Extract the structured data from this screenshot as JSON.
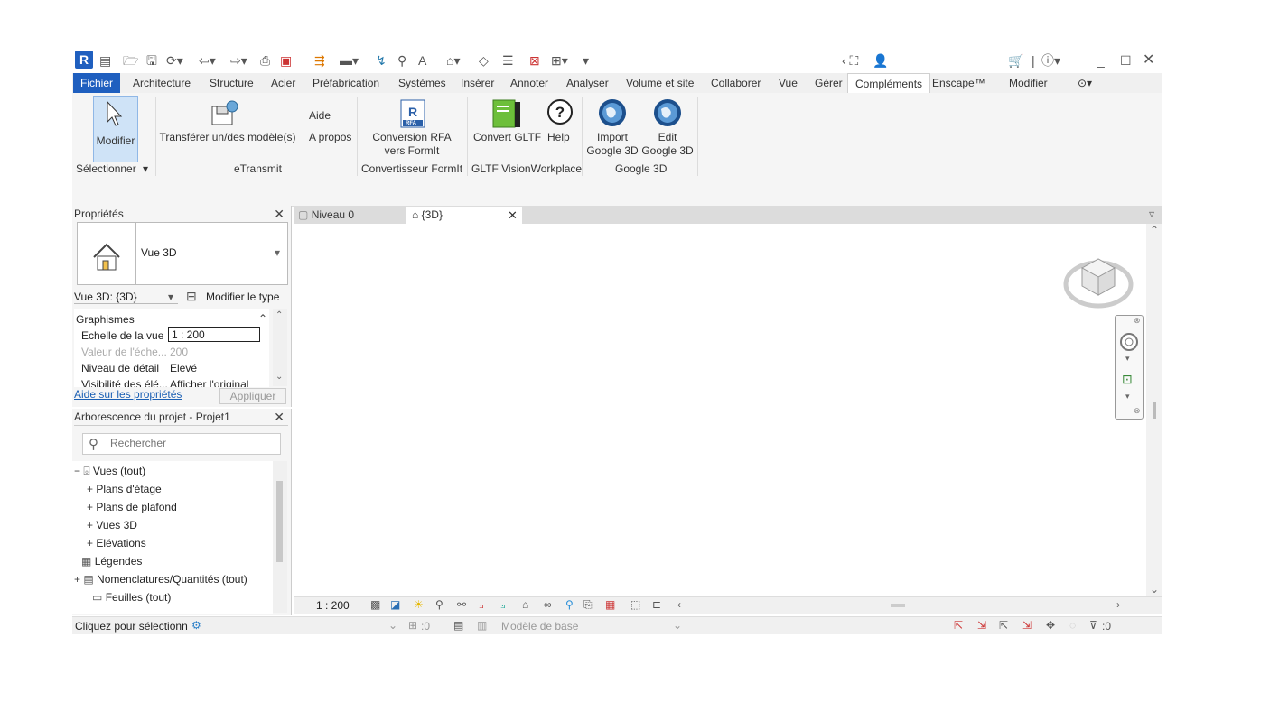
{
  "colors": {
    "accent": "#1f5fbf",
    "ribbon_bg": "#f5f5f5",
    "active_button": "#cfe3f7"
  },
  "app": {
    "logo": "R"
  },
  "ribbon_tabs": [
    "Fichier",
    "Architecture",
    "Structure",
    "Acier",
    "Préfabrication",
    "Systèmes",
    "Insérer",
    "Annoter",
    "Analyser",
    "Volume et site",
    "Collaborer",
    "Vue",
    "Gérer",
    "Compléments",
    "Enscape™",
    "Modifier"
  ],
  "active_tab": "Compléments",
  "ribbon": {
    "modify": "Modifier",
    "select_panel": "Sélectionner",
    "etransmit_button": "Transférer un/des modèle(s)",
    "etransmit_panel": "eTransmit",
    "help_link": "Aide",
    "about_link": "A propos",
    "conversion_line1": "Conversion RFA",
    "conversion_line2": "vers FormIt",
    "rfa_badge": "RFA",
    "formit_panel": "Convertisseur FormIt",
    "convert_gltf": "Convert GLTF",
    "help_gltf": "Help",
    "gltf_panel": "GLTF VisionWorkplace",
    "import_g3d_1": "Import",
    "import_g3d_2": "Google 3D",
    "edit_g3d_1": "Edit",
    "edit_g3d_2": "Google 3D",
    "google_panel": "Google 3D"
  },
  "properties": {
    "title": "Propriétés",
    "type_name": "Vue 3D",
    "instance_selector": "Vue 3D: {3D}",
    "edit_type": "Modifier le type",
    "section": "Graphismes",
    "rows": [
      {
        "label": "Echelle de la vue",
        "value": "1 : 200"
      },
      {
        "label": "Valeur de l'éche...",
        "value": "200"
      },
      {
        "label": "Niveau de détail",
        "value": "Elevé"
      },
      {
        "label": "Visibilité des élé...",
        "value": "Afficher l'original"
      }
    ],
    "help_link": "Aide sur les propriétés",
    "apply": "Appliquer"
  },
  "browser": {
    "title": "Arborescence du projet - Projet1",
    "search_placeholder": "Rechercher",
    "items": [
      {
        "toggle": "−",
        "label": "Vues (tout)"
      },
      {
        "toggle": "+",
        "label": "Plans d'étage"
      },
      {
        "toggle": "+",
        "label": "Plans de plafond"
      },
      {
        "toggle": "+",
        "label": "Vues 3D"
      },
      {
        "toggle": "+",
        "label": "Elévations"
      },
      {
        "toggle": "",
        "label": "Légendes"
      },
      {
        "toggle": "+",
        "label": "Nomenclatures/Quantités (tout)"
      },
      {
        "toggle": "",
        "label": "Feuilles (tout)"
      }
    ]
  },
  "view_tabs": [
    {
      "label": "Niveau 0",
      "active": false
    },
    {
      "label": "{3D}",
      "active": true
    }
  ],
  "view_controls": {
    "scale": "1 : 200"
  },
  "status": {
    "message": "Cliquez pour sélectionn",
    "worksets_count": ":0",
    "model": "Modèle de base",
    "filter_count": ":0"
  }
}
